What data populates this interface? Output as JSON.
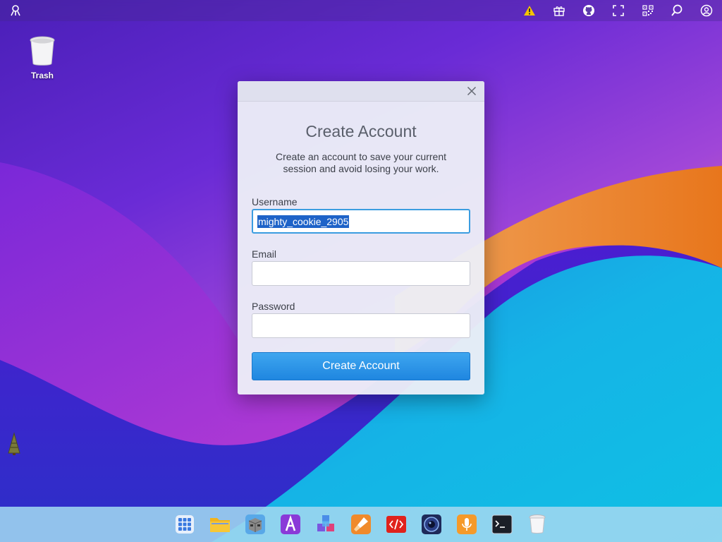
{
  "desktop": {
    "trash_label": "Trash"
  },
  "topbar": {
    "left_icon": "app-menu-icon",
    "right_icons": [
      "warning-icon",
      "gift-icon",
      "github-icon",
      "fullscreen-icon",
      "qr-code-icon",
      "search-icon",
      "user-icon"
    ],
    "warning_color": "#f5c400"
  },
  "dialog": {
    "title": "Create Account",
    "subtitle_line1": "Create an account to save your current",
    "subtitle_line2": "session and avoid losing your work.",
    "username_label": "Username",
    "username_value": "mighty_cookie_2905",
    "email_label": "Email",
    "email_value": "",
    "password_label": "Password",
    "password_value": "",
    "submit_label": "Create Account",
    "accent_color": "#2a93e6"
  },
  "dock": {
    "items": [
      "app-grid-icon",
      "files-folder-icon",
      "package-box-icon",
      "font-a-icon",
      "cubes-icon",
      "brush-icon",
      "code-editor-icon",
      "camera-icon",
      "microphone-icon",
      "terminal-icon",
      "trash-icon"
    ]
  }
}
